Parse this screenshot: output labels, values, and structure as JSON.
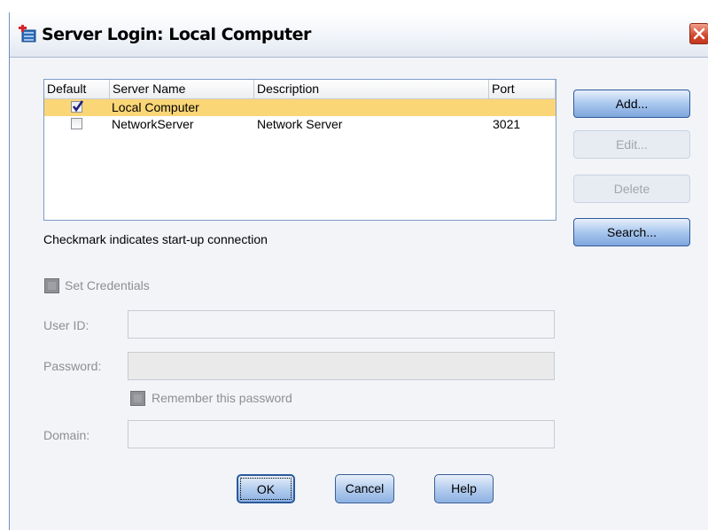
{
  "window": {
    "title": "Server Login: Local Computer",
    "icon": "server-app-icon",
    "close_icon": "close-x-icon"
  },
  "servers": {
    "columns": [
      "Default",
      "Server Name",
      "Description",
      "Port"
    ],
    "rows": [
      {
        "default": true,
        "name": "Local Computer",
        "description": "",
        "port": "",
        "selected": true
      },
      {
        "default": false,
        "name": "NetworkServer",
        "description": "Network Server",
        "port": "3021",
        "selected": false
      }
    ],
    "hint": "Checkmark indicates start-up connection"
  },
  "side_buttons": {
    "add": "Add...",
    "edit": "Edit...",
    "delete": "Delete",
    "search": "Search..."
  },
  "credentials": {
    "set_credentials": "Set Credentials",
    "user_id_label": "User ID:",
    "user_id_value": "",
    "password_label": "Password:",
    "password_value": "",
    "remember": "Remember this password",
    "domain_label": "Domain:",
    "domain_value": ""
  },
  "footer": {
    "ok": "OK",
    "cancel": "Cancel",
    "help": "Help"
  },
  "colors": {
    "selection": "#fbd677",
    "button_border": "#2f5b98",
    "close_red": "#d0462e"
  }
}
